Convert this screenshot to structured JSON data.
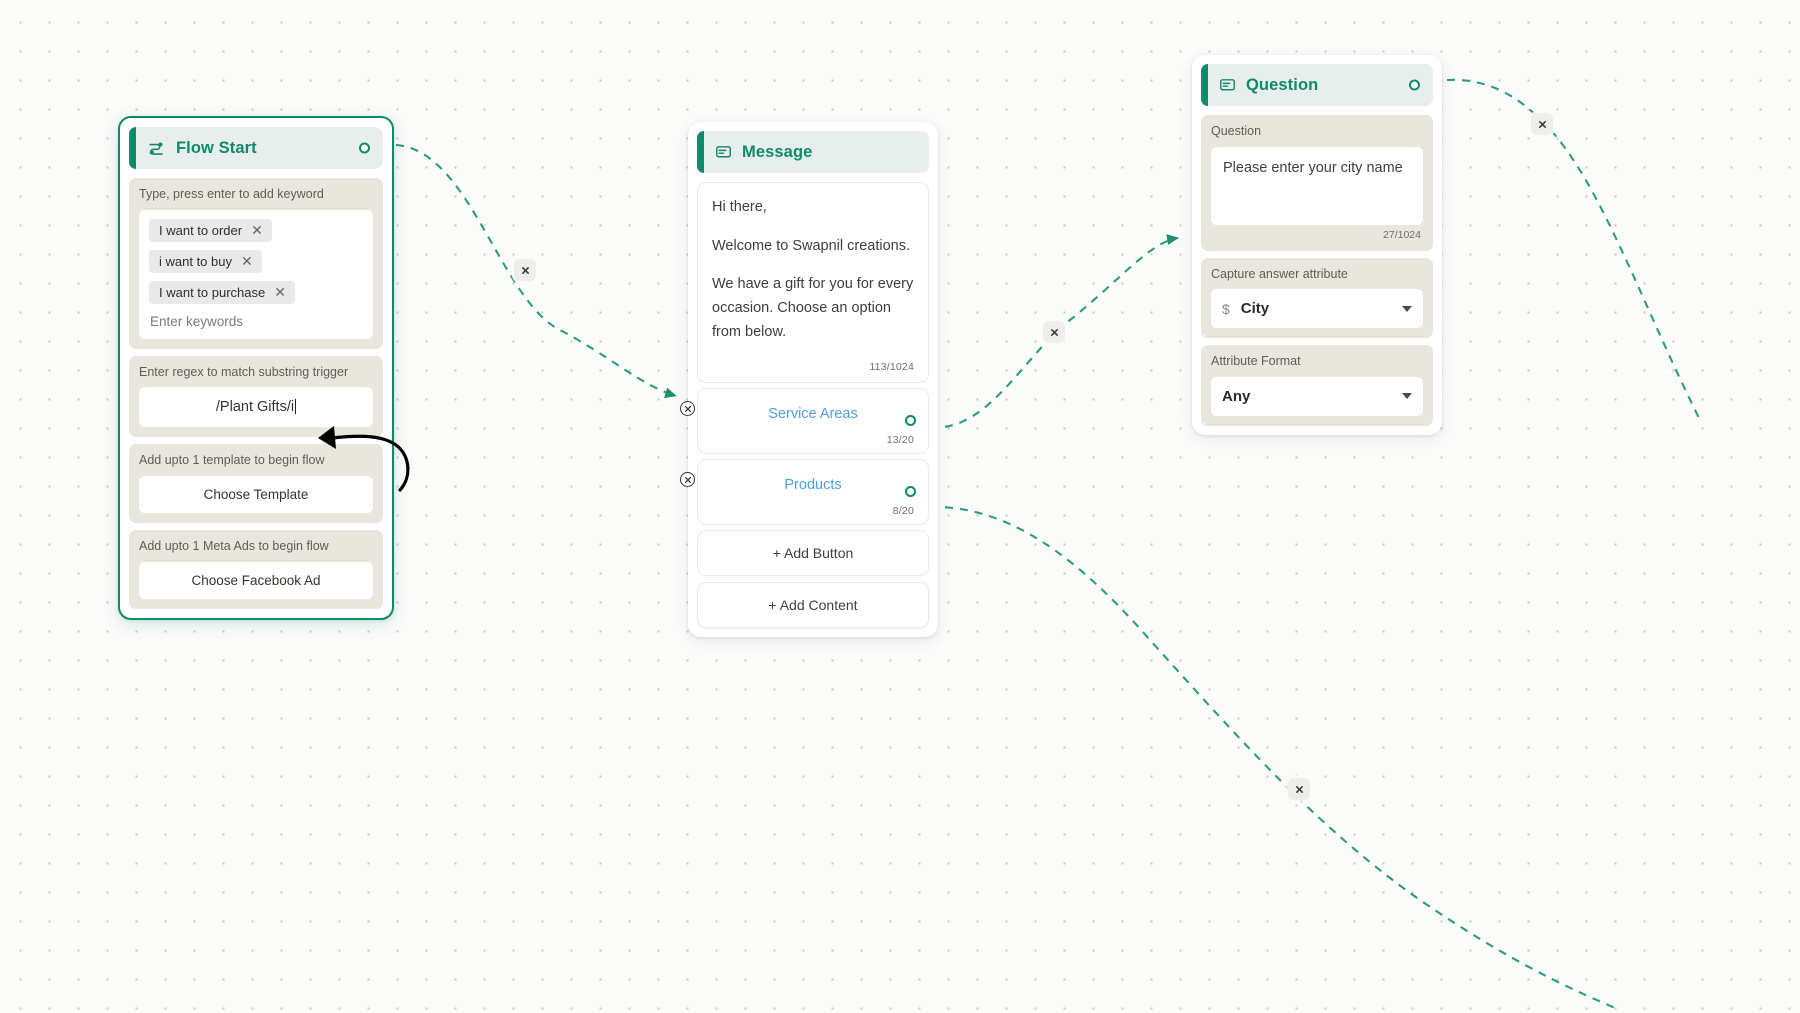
{
  "canvas": {
    "background_color": "#fbfbfa",
    "dot_color": "#c9c9c4",
    "accent_color": "#0f8a6a"
  },
  "nodes": {
    "flow_start": {
      "title": "Flow Start",
      "icon": "flow-start-icon",
      "keywords_label": "Type, press enter to add keyword",
      "keywords": [
        {
          "text": "I want to order"
        },
        {
          "text": "i want to buy"
        },
        {
          "text": "I want to purchase"
        }
      ],
      "keyword_placeholder": "Enter keywords",
      "regex_label": "Enter regex to match substring trigger",
      "regex_value": "/Plant Gifts/i",
      "template_label": "Add upto 1 template to begin flow",
      "template_button": "Choose Template",
      "ads_label": "Add upto 1 Meta Ads to begin flow",
      "ads_button": "Choose Facebook Ad"
    },
    "message": {
      "title": "Message",
      "icon": "message-icon",
      "body_lines": [
        "Hi there,",
        "Welcome to Swapnil creations.",
        "We have a gift for you for every occasion. Choose an option from below."
      ],
      "body_counter": "113/1024",
      "buttons": [
        {
          "label": "Service Areas",
          "counter": "13/20"
        },
        {
          "label": "Products",
          "counter": "8/20"
        }
      ],
      "add_button_label": "+ Add Button",
      "add_content_label": "+ Add Content"
    },
    "question": {
      "title": "Question",
      "icon": "question-icon",
      "question_label": "Question",
      "question_value": "Please enter your city name",
      "question_counter": "27/1024",
      "attribute_label": "Capture answer attribute",
      "attribute_prefix": "$",
      "attribute_value": "City",
      "format_label": "Attribute Format",
      "format_value": "Any"
    }
  },
  "edge_buttons": [
    {
      "name": "edge-delete-flowstart-message",
      "symbol": "✕"
    },
    {
      "name": "edge-delete-message-question",
      "symbol": "✕"
    },
    {
      "name": "edge-delete-question-out",
      "symbol": "✕"
    },
    {
      "name": "edge-delete-products-out",
      "symbol": "✕"
    }
  ]
}
